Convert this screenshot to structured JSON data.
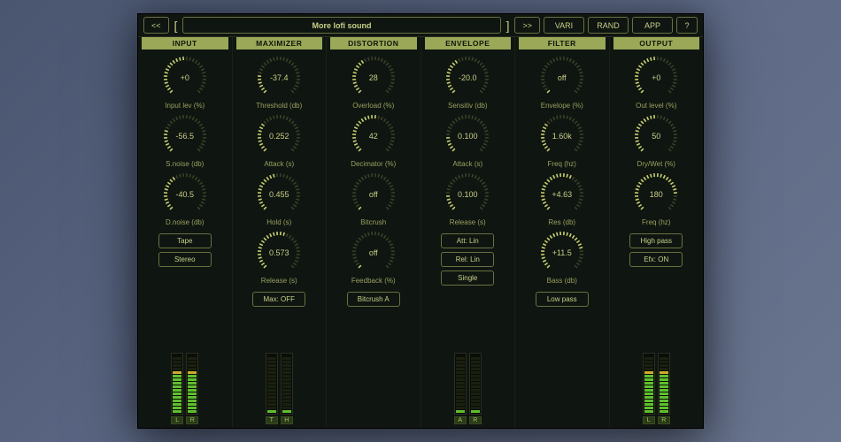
{
  "topbar": {
    "prev": "<<",
    "next": ">>",
    "preset_name": "More lofi sound",
    "vari": "VARI",
    "rand": "RAND",
    "app": "APP",
    "help": "?"
  },
  "columns": {
    "input": {
      "header": "INPUT",
      "knobs": [
        {
          "value": "+0",
          "label": "Input lev (%)",
          "angle": 0.5
        },
        {
          "value": "-56.5",
          "label": "S.noise (db)",
          "angle": 0.25
        },
        {
          "value": "-40.5",
          "label": "D.noise (db)",
          "angle": 0.4
        }
      ],
      "buttons": [
        "Tape",
        "Stereo"
      ],
      "meter_labels": [
        "L",
        "R"
      ],
      "meter_levels": [
        0.78,
        0.78
      ]
    },
    "maximizer": {
      "header": "MAXIMIZER",
      "knobs": [
        {
          "value": "-37.4",
          "label": "Threshold (db)",
          "angle": 0.22
        },
        {
          "value": "0.252",
          "label": "Attack (s)",
          "angle": 0.3
        },
        {
          "value": "0.455",
          "label": "Hold (s)",
          "angle": 0.48
        },
        {
          "value": "0.573",
          "label": "Release (s)",
          "angle": 0.58
        }
      ],
      "buttons": [
        "Max: OFF"
      ],
      "meter_labels": [
        "T",
        "H"
      ],
      "meter_levels": [
        0.0,
        0.0
      ]
    },
    "distortion": {
      "header": "DISTORTION",
      "knobs": [
        {
          "value": "28",
          "label": "Overload (%)",
          "angle": 0.38
        },
        {
          "value": "42",
          "label": "Decimator (%)",
          "angle": 0.55
        },
        {
          "value": "off",
          "label": "Bitcrush",
          "angle": 0.0
        },
        {
          "value": "off",
          "label": "Feedback (%)",
          "angle": 0.0
        }
      ],
      "buttons": [
        "Bitcrush A"
      ]
    },
    "envelope": {
      "header": "ENVELOPE",
      "knobs": [
        {
          "value": "-20.0",
          "label": "Sensitiv (db)",
          "angle": 0.4
        },
        {
          "value": "0.100",
          "label": "Attack (s)",
          "angle": 0.18
        },
        {
          "value": "0.100",
          "label": "Release (s)",
          "angle": 0.18
        }
      ],
      "buttons": [
        "Att: Lin",
        "Rel: Lin",
        "Single"
      ],
      "meter_labels": [
        "A",
        "R"
      ],
      "meter_levels": [
        0.0,
        0.0
      ]
    },
    "filter": {
      "header": "FILTER",
      "knobs": [
        {
          "value": "off",
          "label": "Envelope (%)",
          "angle": 0.0
        },
        {
          "value": "1.60k",
          "label": "Freq (hz)",
          "angle": 0.32
        },
        {
          "value": "+4.63",
          "label": "Res (db)",
          "angle": 0.6
        },
        {
          "value": "+11.5",
          "label": "Bass (db)",
          "angle": 0.78
        }
      ],
      "buttons": [
        "Low pass"
      ]
    },
    "output": {
      "header": "OUTPUT",
      "knobs": [
        {
          "value": "+0",
          "label": "Out level (%)",
          "angle": 0.5
        },
        {
          "value": "50",
          "label": "Dry/Wet (%)",
          "angle": 0.5
        },
        {
          "value": "180",
          "label": "Freq (hz)",
          "angle": 0.82
        }
      ],
      "buttons": [
        "High pass",
        "Efx: ON"
      ],
      "meter_labels": [
        "L",
        "R"
      ],
      "meter_levels": [
        0.78,
        0.78
      ]
    }
  }
}
